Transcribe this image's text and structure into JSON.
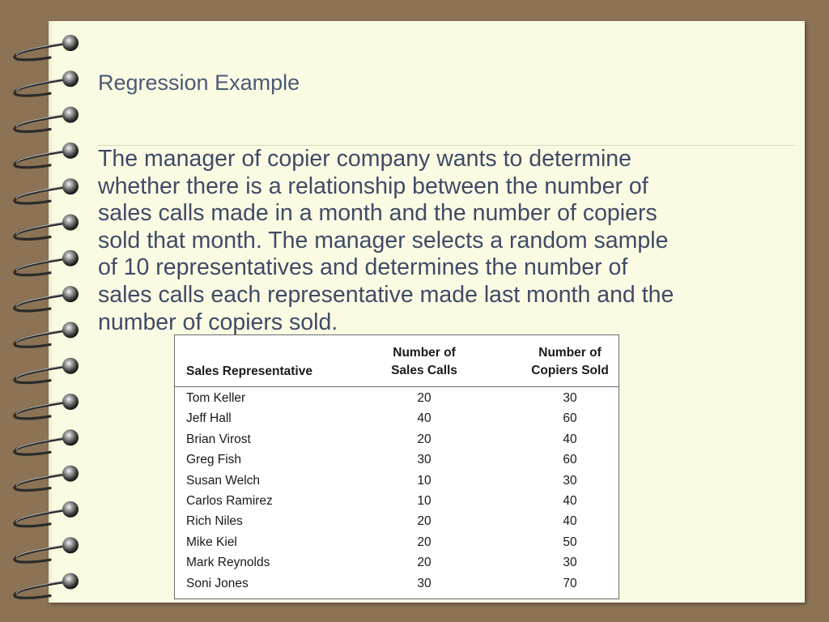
{
  "slide": {
    "title": "Regression Example",
    "body": "The manager of copier company wants to determine\nwhether there is a relationship between the number of\nsales calls made in a month and the number of copiers\nsold that month. The manager selects a random sample\nof 10 representatives and determines the number of\nsales calls each representative made last month and the\nnumber of copiers sold."
  },
  "table": {
    "headers": {
      "rep": "Sales Representative",
      "calls_line1": "Number of",
      "calls_line2": "Sales Calls",
      "copiers_line1": "Number of",
      "copiers_line2": "Copiers Sold"
    },
    "rows": [
      {
        "name": "Tom Keller",
        "calls": "20",
        "copiers": "30"
      },
      {
        "name": "Jeff Hall",
        "calls": "40",
        "copiers": "60"
      },
      {
        "name": "Brian Virost",
        "calls": "20",
        "copiers": "40"
      },
      {
        "name": "Greg Fish",
        "calls": "30",
        "copiers": "60"
      },
      {
        "name": "Susan Welch",
        "calls": "10",
        "copiers": "30"
      },
      {
        "name": "Carlos Ramirez",
        "calls": "10",
        "copiers": "40"
      },
      {
        "name": "Rich Niles",
        "calls": "20",
        "copiers": "40"
      },
      {
        "name": "Mike Kiel",
        "calls": "20",
        "copiers": "50"
      },
      {
        "name": "Mark Reynolds",
        "calls": "20",
        "copiers": "30"
      },
      {
        "name": "Soni Jones",
        "calls": "30",
        "copiers": "70"
      }
    ]
  },
  "colors": {
    "background": "#8c7355",
    "paper": "#fbfbe4",
    "text": "#3f4b66"
  },
  "icons": {
    "binding": "spiral-binding-icon"
  }
}
